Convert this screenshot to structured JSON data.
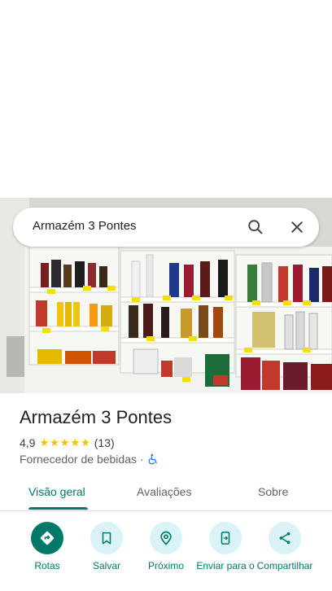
{
  "search": {
    "query": "Armazém 3 Pontes"
  },
  "place": {
    "name": "Armazém 3 Pontes",
    "rating": "4,9",
    "stars": 5,
    "review_count": "(13)",
    "category": "Fornecedor de bebidas",
    "separator": "·"
  },
  "tabs": [
    {
      "label": "Visão geral",
      "active": true
    },
    {
      "label": "Avaliações",
      "active": false
    },
    {
      "label": "Sobre",
      "active": false
    }
  ],
  "actions": [
    {
      "label": "Rotas",
      "icon": "directions-icon"
    },
    {
      "label": "Salvar",
      "icon": "bookmark-icon"
    },
    {
      "label": "Próximo",
      "icon": "nearby-icon"
    },
    {
      "label": "Enviar para o",
      "icon": "send-to-phone-icon"
    },
    {
      "label": "Compartilhar",
      "icon": "share-icon"
    }
  ],
  "colors": {
    "accent": "#00796b",
    "star": "#fbbc04",
    "action_bg": "#d9f3f8"
  }
}
